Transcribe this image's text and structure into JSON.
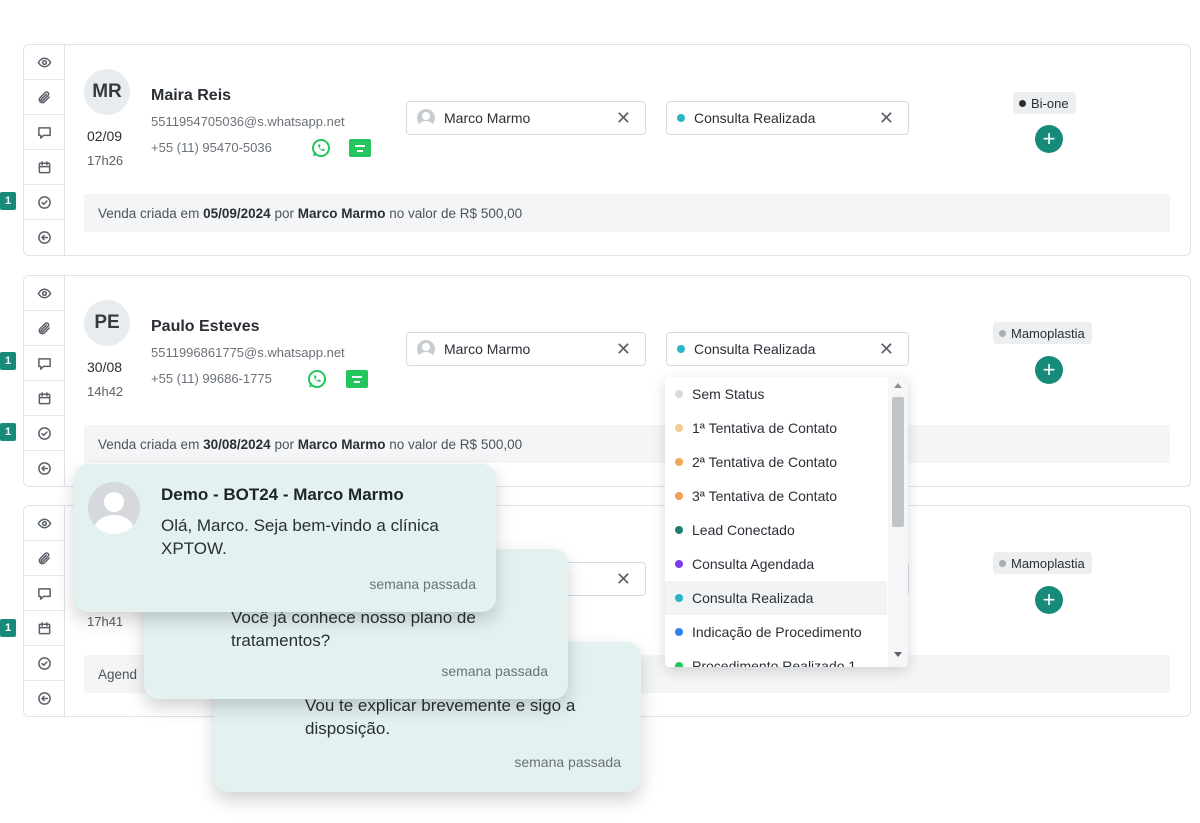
{
  "rail_icons": [
    "eye-icon",
    "paperclip-icon",
    "chat-icon",
    "calendar-icon",
    "check-circle-icon",
    "arrow-left-circle-icon"
  ],
  "cards": [
    {
      "initials": "MR",
      "date": "02/09",
      "time": "17h26",
      "name": "Maira Reis",
      "email": "5511954705036@s.whatsapp.net",
      "phone": "+55 (11) 95470-5036",
      "owner": "Marco Marmo",
      "status": "Consulta Realizada",
      "tag": "Bi-one",
      "sale": {
        "pre": "Venda criada em ",
        "date": "05/09/2024",
        "mid": " por ",
        "user": "Marco Marmo",
        "post": " no valor de R$ 500,00"
      },
      "badges": {
        "check": "1"
      }
    },
    {
      "initials": "PE",
      "date": "30/08",
      "time": "14h42",
      "name": "Paulo Esteves",
      "email": "5511996861775@s.whatsapp.net",
      "phone": "+55 (11) 99686-1775",
      "owner": "Marco Marmo",
      "status": "Consulta Realizada",
      "tag": "Mamoplastia",
      "sale": {
        "pre": "Venda criada em ",
        "date": "30/08/2024",
        "mid": " por ",
        "user": "Marco Marmo",
        "post": " no valor de R$ 500,00"
      },
      "badges": {
        "chat": "1",
        "check": "1"
      }
    },
    {
      "time": "17h41",
      "tag": "Mamoplastia",
      "footer_text": "Agend",
      "badges": {
        "calendar": "1"
      }
    }
  ],
  "status_options": [
    {
      "label": "Sem Status",
      "color": "#d6d9dc"
    },
    {
      "label": "1ª Tentativa de Contato",
      "color": "#f4c98e"
    },
    {
      "label": "2ª Tentativa de Contato",
      "color": "#f2a65a"
    },
    {
      "label": "3ª Tentativa de Contato",
      "color": "#f0a050"
    },
    {
      "label": "Lead Conectado",
      "color": "#1b7e72"
    },
    {
      "label": "Consulta Agendada",
      "color": "#7c3aed"
    },
    {
      "label": "Consulta Realizada",
      "color": "#2bb3c8"
    },
    {
      "label": "Indicação de Procedimento",
      "color": "#2f80ed"
    },
    {
      "label": "Procedimento Realizado 1",
      "color": "#22c55e"
    }
  ],
  "status_dot_color": "#2bb3c8",
  "tag_colors": {
    "Bi-one": "#2a2f36",
    "Mamoplastia": "#a9aeb3"
  },
  "notifications": [
    {
      "title": "Demo - BOT24 - Marco Marmo",
      "text": "Olá, Marco. Seja bem-vindo a clínica XPTOW.",
      "time": "semana passada"
    },
    {
      "text": "Você já conhece nosso plano de tratamentos?",
      "time": "semana passada"
    },
    {
      "text": "Vou te explicar brevemente e sigo a disposição.",
      "time": "semana passada"
    }
  ]
}
